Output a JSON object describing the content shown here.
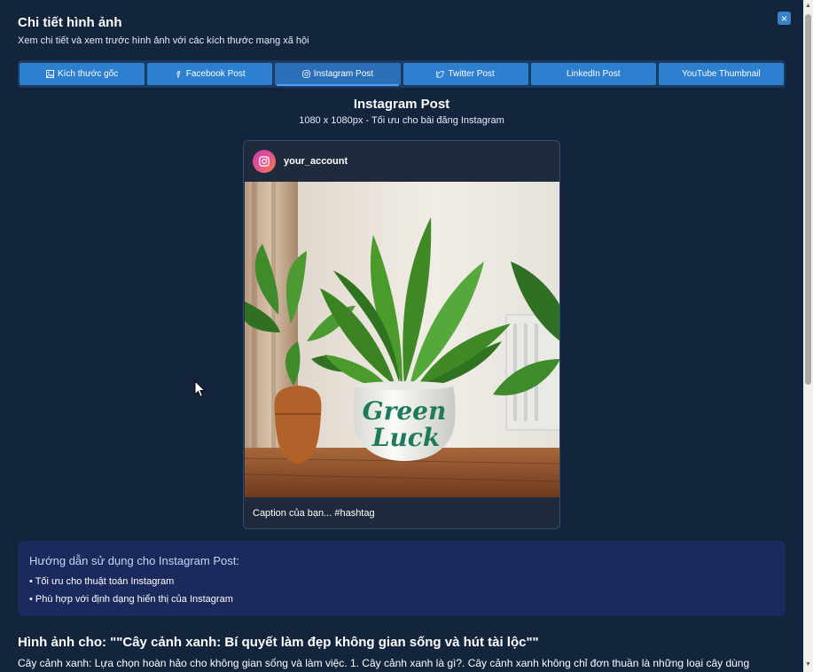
{
  "modal": {
    "title": "Chi tiết hình ảnh",
    "subtitle": "Xem chi tiết và xem trước hình ảnh với các kích thước mạng xã hội",
    "close_label": "×"
  },
  "tabs": [
    {
      "label": "Kích thước gốc",
      "icon": "image-icon",
      "active": false
    },
    {
      "label": "Facebook Post",
      "icon": "facebook-icon",
      "active": false
    },
    {
      "label": "Instagram Post",
      "icon": "instagram-icon",
      "active": true
    },
    {
      "label": "Twitter Post",
      "icon": "twitter-icon",
      "active": false
    },
    {
      "label": "LinkedIn Post",
      "icon": "",
      "active": false
    },
    {
      "label": "YouTube Thumbnail",
      "icon": "",
      "active": false
    }
  ],
  "preview": {
    "title": "Instagram Post",
    "subtitle": "1080 x 1080px - Tối ưu cho bài đăng Instagram",
    "account": "your_account",
    "caption": "Caption của bạn... #hashtag",
    "image_text_line1": "Green",
    "image_text_line2": "Luck"
  },
  "guide": {
    "title": "Hướng dẫn sử dụng cho Instagram Post:",
    "items": [
      "• Tối ưu cho thuật toán Instagram",
      "• Phù hợp với định dạng hiển thị của Instagram"
    ]
  },
  "post": {
    "title": "Hình ảnh cho: \"\"Cây cảnh xanh: Bí quyết làm đẹp không gian sống và hút tài lộc\"\"",
    "body": "Cây cảnh xanh: Lựa chọn hoàn hảo cho không gian sống và làm việc. 1. Cây cảnh xanh là gì?. Cây cảnh xanh không chỉ đơn thuần là những loại cây dùng"
  },
  "colors": {
    "background": "#13243d",
    "tab": "#2d7fd0",
    "guide_bg": "#1b2a5c",
    "accent": "#4aa3ff"
  }
}
